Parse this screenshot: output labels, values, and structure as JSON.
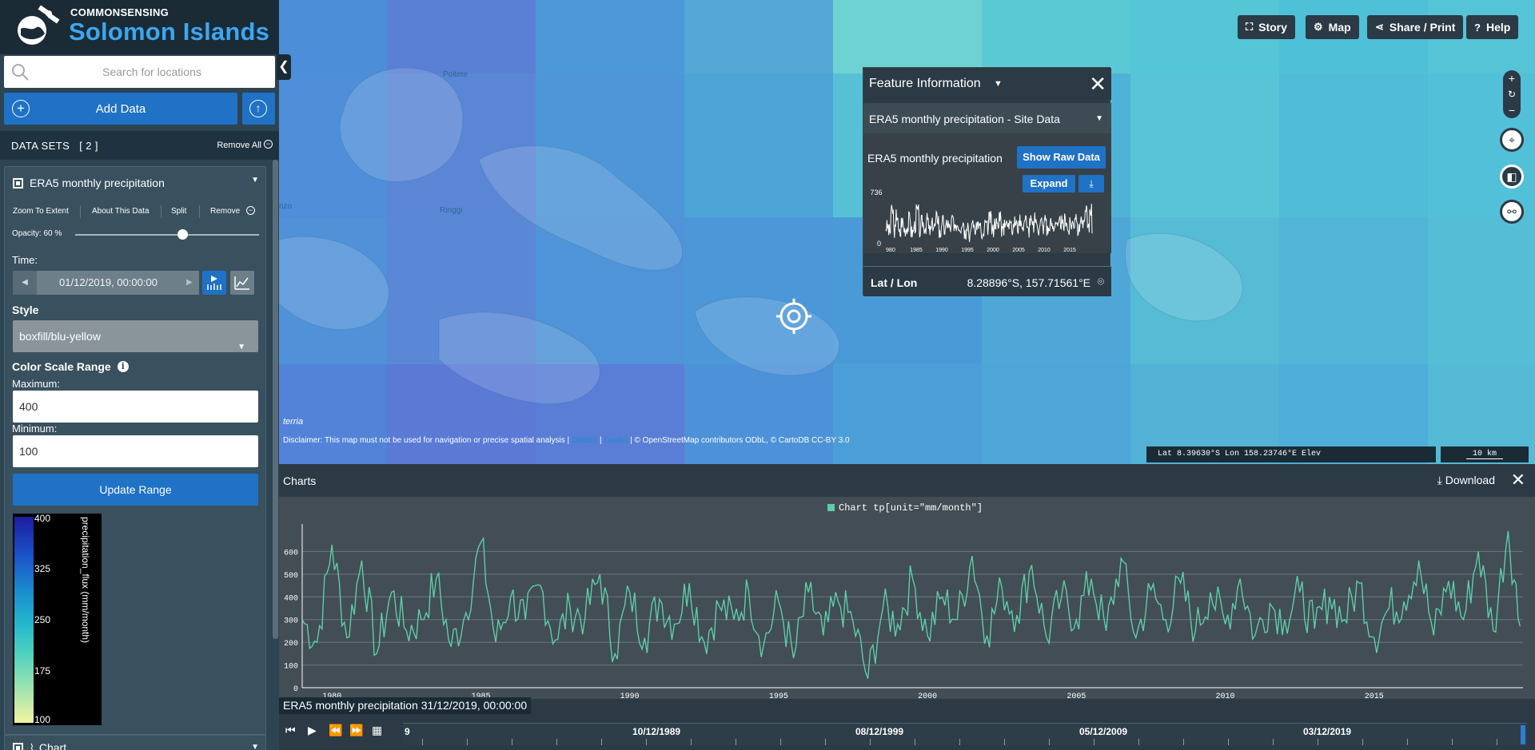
{
  "brand": {
    "top": "COMMONSENSING",
    "name": "Solomon Islands"
  },
  "search": {
    "placeholder": "Search for locations"
  },
  "sidebar": {
    "add_data": "Add Data",
    "datasets_label": "DATA SETS   [ 2 ]",
    "remove_all": "Remove All"
  },
  "item": {
    "title": "ERA5 monthly precipitation",
    "actions": [
      "Zoom To Extent",
      "About This Data",
      "Split",
      "Remove"
    ],
    "opacity": "Opacity: 60 %",
    "opacity_value": 0.6,
    "time_label": "Time:",
    "time_value": "01/12/2019, 00:00:00",
    "style_label": "Style",
    "style_value": "boxfill/blu-yellow",
    "csr_label": "Color Scale Range",
    "max_label": "Maximum:",
    "max_value": "400",
    "min_label": "Minimum:",
    "min_value": "100",
    "update": "Update Range",
    "legend_ticks": [
      "400",
      "325",
      "250",
      "175",
      "100"
    ],
    "legend_unit": "precipitation_flux (mm/month)"
  },
  "item2": {
    "title": "Chart"
  },
  "map": {
    "labels": [
      "Poitete",
      "Ringgi",
      "nzo"
    ],
    "disclaimer_text": "Disclaimer: This map must not be used for navigation or precise spatial analysis |",
    "data61": "Data61",
    "leaflet": "Leaflet",
    "attribution": "| © OpenStreetMap contributors ODbL, © CartoDB CC-BY 3.0",
    "terria": "terria",
    "coords": "Lat  8.39630°S    Lon  158.23746°E   Elev",
    "scale": "10 km"
  },
  "topbar": {
    "story": "Story",
    "map": "Map",
    "share": "Share / Print",
    "help": "Help"
  },
  "feature_info": {
    "title": "Feature Information",
    "subtitle": "ERA5 monthly precipitation - Site Data",
    "label": "ERA5 monthly precipitation",
    "show_raw": "Show Raw Data",
    "expand": "Expand",
    "spark_max": "736",
    "spark_min": "0",
    "spark_xlabels": [
      "980",
      "1985",
      "1990",
      "1995",
      "2000",
      "2005",
      "2010",
      "2015"
    ],
    "latlon_label": "Lat / Lon",
    "latlon_value": "8.28896°S, 157.71561°E"
  },
  "charts": {
    "title": "Charts",
    "download": "Download",
    "legend": "Chart tp[unit=\"mm/month\"]"
  },
  "chart_data": {
    "type": "line",
    "title": "",
    "series": [
      {
        "name": "Chart tp[unit=\"mm/month\"]"
      }
    ],
    "xlim": [
      1979,
      2020
    ],
    "ylim": [
      0,
      700
    ],
    "yticks": [
      0,
      100,
      200,
      300,
      400,
      500,
      600
    ],
    "xticks": [
      1980,
      1985,
      1990,
      1995,
      2000,
      2005,
      2010,
      2015
    ],
    "grid": true,
    "legend": "top-center",
    "x": [
      1979.0,
      1979.5,
      1980.0,
      1980.5,
      1981.0,
      1981.5,
      1982.0,
      1982.5,
      1983.0,
      1983.5,
      1984.0,
      1984.5,
      1985.0,
      1985.5,
      1986.0,
      1986.5,
      1987.0,
      1987.5,
      1988.0,
      1988.5,
      1989.0,
      1989.5,
      1990.0,
      1990.5,
      1991.0,
      1991.5,
      1992.0,
      1992.5,
      1993.0,
      1993.5,
      1994.0,
      1994.5,
      1995.0,
      1995.5,
      1996.0,
      1996.5,
      1997.0,
      1997.5,
      1998.0,
      1998.5,
      1999.0,
      1999.5,
      2000.0,
      2000.5,
      2001.0,
      2001.5,
      2002.0,
      2002.5,
      2003.0,
      2003.5,
      2004.0,
      2004.5,
      2005.0,
      2005.5,
      2006.0,
      2006.5,
      2007.0,
      2007.5,
      2008.0,
      2008.5,
      2009.0,
      2009.5,
      2010.0,
      2010.5,
      2011.0,
      2011.5,
      2012.0,
      2012.5,
      2013.0,
      2013.5,
      2014.0,
      2014.5,
      2015.0,
      2015.5,
      2016.0,
      2016.5,
      2017.0,
      2017.5,
      2018.0,
      2018.5,
      2019.0,
      2019.5,
      2019.9
    ],
    "values": [
      300,
      200,
      630,
      220,
      560,
      150,
      420,
      250,
      300,
      480,
      180,
      330,
      640,
      200,
      400,
      300,
      450,
      210,
      350,
      310,
      500,
      150,
      420,
      220,
      390,
      280,
      460,
      200,
      360,
      300,
      420,
      190,
      380,
      130,
      420,
      230,
      380,
      290,
      40,
      350,
      280,
      480,
      230,
      400,
      300,
      580,
      230,
      440,
      320,
      540,
      220,
      400,
      300,
      480,
      250,
      570,
      220,
      430,
      300,
      460,
      250,
      420,
      280,
      480,
      230,
      370,
      300,
      420,
      260,
      400,
      300,
      460,
      220,
      350,
      380,
      560,
      230,
      470,
      300,
      600,
      250,
      700,
      270
    ]
  }
}
